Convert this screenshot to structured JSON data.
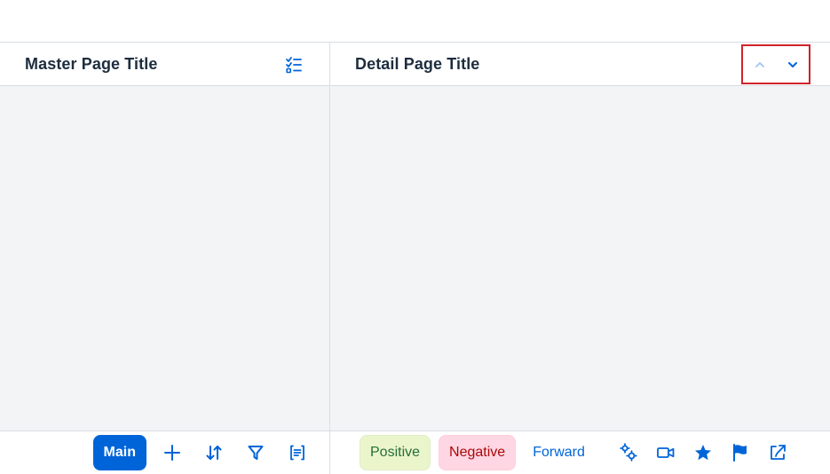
{
  "master": {
    "title": "Master Page Title",
    "header_action_icon": "multi-select-icon",
    "footer": {
      "main_label": "Main",
      "icons": [
        "add-icon",
        "sort-icon",
        "filter-icon",
        "group-icon"
      ]
    }
  },
  "detail": {
    "title": "Detail Page Title",
    "nav": {
      "up_icon": "navigation-up-arrow-icon",
      "down_icon": "navigation-down-arrow-icon"
    },
    "footer": {
      "positive_label": "Positive",
      "negative_label": "Negative",
      "forward_label": "Forward",
      "icons": [
        "settings-icon",
        "video-icon",
        "favorite-icon",
        "flag-icon",
        "share-icon"
      ]
    }
  },
  "colors": {
    "brand": "#0064d9",
    "positive_bg": "#ebf5cb",
    "positive_text": "#256f3a",
    "negative_bg": "#ffd6e3",
    "negative_text": "#aa0808",
    "content_bg": "#f3f4f6",
    "highlight_border": "#d0222a"
  }
}
